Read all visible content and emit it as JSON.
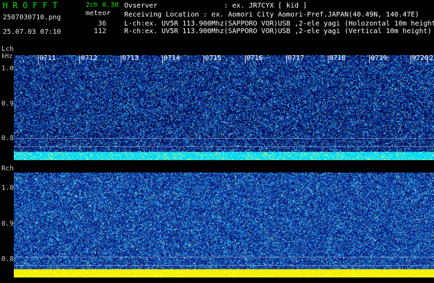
{
  "header": {
    "app_title": "HROFFT",
    "mode": "2ch 0.30",
    "filename": "2507030710.png",
    "datetime": "25.07.03 07:10",
    "event_label": "meteor",
    "count_l": "36",
    "count_r": "112"
  },
  "info": {
    "observer": "Ovserver                : ex. JR7CYX [ kid ]",
    "location": "Receiving Location : ex. Aomori City Aomori-Pref.JAPAN(40.49N, 140.47E)",
    "lch": "L-ch:ex. UV5R 113.900Mhz(SAPPORO VOR)USB ,2-ele yagi (Holozontal 10m height)",
    "rch": "R-ch:ex. UV5R 113.900Mhz(SAPPORO VOR)USB ,2-ele yagi (Vertical 10m height)"
  },
  "lch_panel": {
    "label": "Lch",
    "unit": "kHz",
    "yticks": [
      "1.0",
      "0.9",
      "0.8"
    ]
  },
  "rch_panel": {
    "label": "Rch",
    "yticks": [
      "1.0",
      "0.9",
      "0.8"
    ]
  },
  "time_ticks": [
    "0711",
    "0712",
    "0713",
    "0714",
    "0715",
    "0716",
    "0717",
    "0718",
    "0719",
    "0720",
    "2"
  ],
  "colors": {
    "background": "#000000",
    "waterfall_low": "#0a1a6e",
    "waterfall_mid": "#2266cc",
    "waterfall_high": "#33ddff",
    "lch_baseline": "#00d8ff",
    "rch_baseline": "#ffff00",
    "title_green": "#00e000"
  }
}
